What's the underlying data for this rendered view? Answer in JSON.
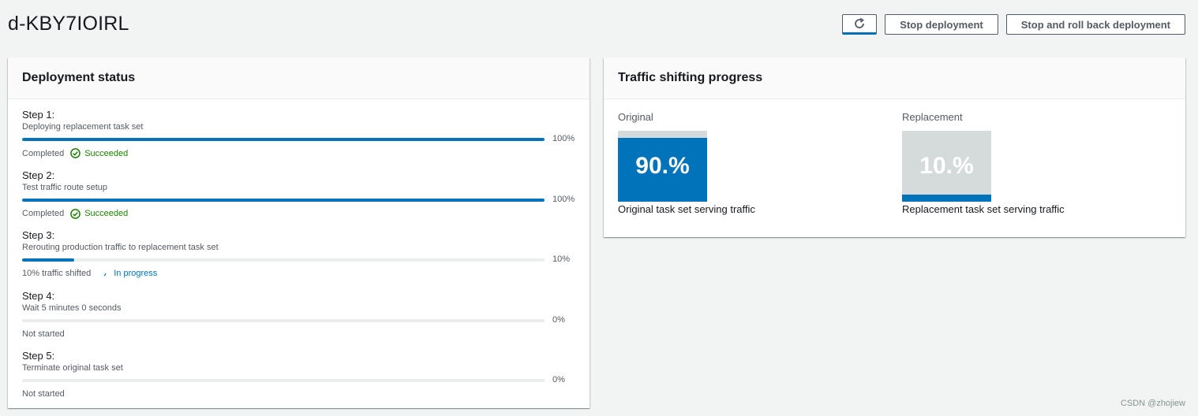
{
  "page": {
    "title": "d-KBY7IOIRL"
  },
  "actions": {
    "stop_label": "Stop deployment",
    "rollback_label": "Stop and roll back deployment"
  },
  "deployment": {
    "heading": "Deployment status",
    "steps": [
      {
        "title": "Step 1:",
        "desc": "Deploying replacement task set",
        "progress": 100,
        "pct_label": "100%",
        "status_text": "Completed",
        "badge": "Succeeded",
        "badge_type": "success"
      },
      {
        "title": "Step 2:",
        "desc": "Test traffic route setup",
        "progress": 100,
        "pct_label": "100%",
        "status_text": "Completed",
        "badge": "Succeeded",
        "badge_type": "success"
      },
      {
        "title": "Step 3:",
        "desc": "Rerouting production traffic to replacement task set",
        "progress": 10,
        "pct_label": "10%",
        "status_text": "10% traffic shifted",
        "badge": "In progress",
        "badge_type": "in-progress"
      },
      {
        "title": "Step 4:",
        "desc": "Wait 5 minutes 0 seconds",
        "progress": 0,
        "pct_label": "0%",
        "status_text": "Not started",
        "badge": "",
        "badge_type": "none"
      },
      {
        "title": "Step 5:",
        "desc": "Terminate original task set",
        "progress": 0,
        "pct_label": "0%",
        "status_text": "Not started",
        "badge": "",
        "badge_type": "none"
      }
    ]
  },
  "traffic": {
    "heading": "Traffic shifting progress",
    "original": {
      "label": "Original",
      "pct_label": "90.%",
      "fill_pct": 90,
      "caption": "Original task set serving traffic"
    },
    "replacement": {
      "label": "Replacement",
      "pct_label": "10.%",
      "fill_pct": 10,
      "caption": "Replacement task set serving traffic"
    }
  },
  "watermark": "CSDN @zhojiew",
  "colors": {
    "accent": "#0073bb",
    "success": "#1d8102",
    "track": "#eaeded",
    "box_bg": "#d5dbdb"
  }
}
